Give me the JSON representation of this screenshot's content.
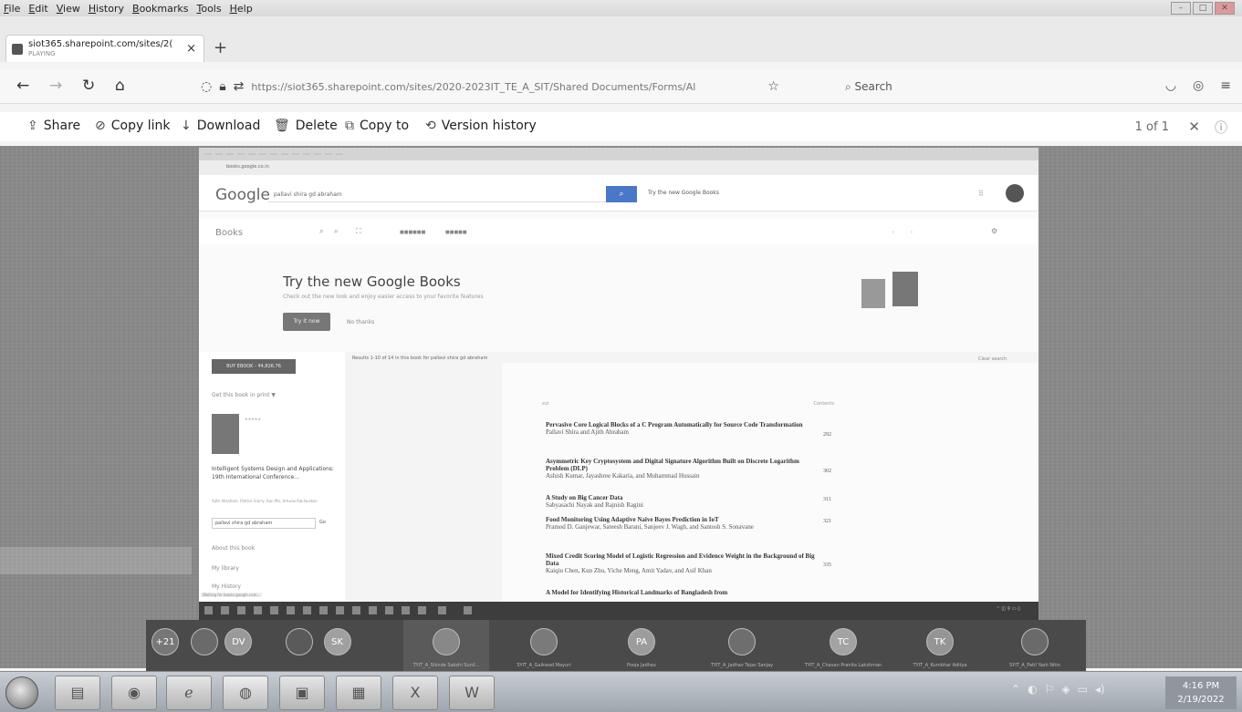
{
  "menubar": {
    "items": [
      "File",
      "Edit",
      "View",
      "History",
      "Bookmarks",
      "Tools",
      "Help"
    ]
  },
  "browser": {
    "tab_title": "siot365.sharepoint.com/sites/2(",
    "tab_subtitle": "PLAYING",
    "tab_close": "×",
    "new_tab": "+",
    "url": "https://siot365.sharepoint.com/sites/2020-2023IT_TE_A_SIT/Shared Documents/Forms/Al",
    "search_placeholder": "Search",
    "page_count": "1 of 1"
  },
  "toolbar": {
    "share": "Share",
    "copy_link": "Copy link",
    "download": "Download",
    "delete": "Delete",
    "copy_to": "Copy to",
    "version_history": "Version history"
  },
  "inner": {
    "google_logo": "Google",
    "search_query": "pallavi shira gd abraham",
    "try_new_google_books_short": "Try the new Google Books",
    "books_label": "Books",
    "try_title": "Try the new Google Books",
    "try_desc": "Check out the new look and enjoy easier access to your favorite features",
    "try_button": "Try it now",
    "no_thanks": "No thanks",
    "sidebar_button": "BUY EBOOK - ₹4,826.76",
    "sidebar_filter": "Get this book in print ▼",
    "book_title": "Intelligent Systems Design and Applications: 19th International Conference...",
    "book_meta": "Ajith Abraham, Patrick Siarry, Kun Ma, Arturas Kaklauskas",
    "sidebar_search": "pallavi shira gd abraham",
    "sidebar_go": "Go",
    "sidebar_link1": "About this book",
    "sidebar_link2": "My library",
    "sidebar_link3": "My History",
    "results_header": "Results 1-10 of 14 in this book for pallavi shira gd abraham",
    "results_link": "Clear search",
    "toc_header_left": "xvi",
    "toc_header_right": "Contents",
    "status_text": "Waiting for books.google.com..."
  },
  "toc": [
    {
      "title": "Pervasive Core Logical Blocks of a C Program Automatically for Source Code Transformation",
      "authors": "Pallavi Shira and Ajith Abraham",
      "page": "292"
    },
    {
      "title": "Asymmetric Key Cryptosystem and Digital Signature Algorithm Built on Discrete Logarithm Problem (DLP)",
      "authors": "Ashish Kumar, Jayashree Kakaria, and Muhammad Hussain",
      "page": "302"
    },
    {
      "title": "A Study on Big Cancer Data",
      "authors": "Sabyasachi Nayak and Rajnish Ragini",
      "page": "311"
    },
    {
      "title": "Food Monitoring Using Adaptive Naive Bayes Prediction in IoT",
      "authors": "Pramod D. Ganjewar, Sateesh Barani, Sanjeev J. Wagh, and Santosh S. Sonavane",
      "page": "321"
    },
    {
      "title": "Mixed Credit Scoring Model of Logistic Regression and Evidence Weight in the Background of Big Data",
      "authors": "Kaiqiu Chen, Kun Zhu, Yiche Meng, Amit Yadav, and Asif Khan",
      "page": "335"
    },
    {
      "title": "A Model for Identifying Historical Landmarks of Bangladesh from",
      "authors": "",
      "page": ""
    }
  ],
  "participants": [
    {
      "initials": "+21",
      "name": ""
    },
    {
      "initials": "",
      "name": ""
    },
    {
      "initials": "DV",
      "name": ""
    },
    {
      "initials": "",
      "name": ""
    },
    {
      "initials": "SK",
      "name": ""
    },
    {
      "initials": "",
      "name": "TYIT_A_Shinde Sakshi Sunil..."
    },
    {
      "initials": "",
      "name": "SYIT_A_Gaikwad Mayuri"
    },
    {
      "initials": "PA",
      "name": "Pooja Jadhav"
    },
    {
      "initials": "",
      "name": "TYIT_A_Jadhav Tejas Sanjay"
    },
    {
      "initials": "TC",
      "name": "TYIT_A_Chavan Pranita Lakshman"
    },
    {
      "initials": "TK",
      "name": "TYIT_A_Kumbhar Aditya"
    },
    {
      "initials": "",
      "name": "SYIT_A_Patil Yash Nitin"
    }
  ],
  "taskbar": {
    "time": "4:16 PM",
    "date": "2/19/2022"
  }
}
